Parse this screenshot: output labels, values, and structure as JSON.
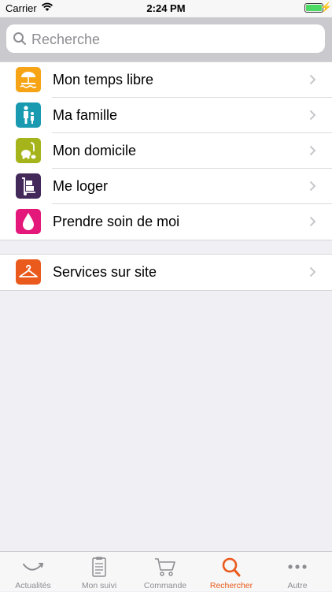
{
  "status_bar": {
    "carrier": "Carrier",
    "time": "2:24 PM"
  },
  "search": {
    "placeholder": "Recherche"
  },
  "menu": [
    {
      "label": "Mon temps libre",
      "icon": "beach-umbrella-icon",
      "color": "#f6a416"
    },
    {
      "label": "Ma famille",
      "icon": "family-icon",
      "color": "#1a9ab0"
    },
    {
      "label": "Mon domicile",
      "icon": "vacuum-cleaner-icon",
      "color": "#a5b41a"
    },
    {
      "label": "Me loger",
      "icon": "moving-cart-icon",
      "color": "#43285a"
    },
    {
      "label": "Prendre soin de moi",
      "icon": "drop-icon",
      "color": "#e3187a"
    }
  ],
  "services": [
    {
      "label": "Services sur site",
      "icon": "hanger-icon",
      "color": "#e95a1c"
    }
  ],
  "tabs": [
    {
      "label": "Actualités",
      "icon": "news-swoosh-icon"
    },
    {
      "label": "Mon suivi",
      "icon": "clipboard-icon"
    },
    {
      "label": "Commande",
      "icon": "cart-icon"
    },
    {
      "label": "Rechercher",
      "icon": "search-icon",
      "active": true
    },
    {
      "label": "Autre",
      "icon": "more-icon"
    }
  ],
  "colors": {
    "accent": "#e95a1c",
    "tab_inactive": "#8e8e93"
  }
}
